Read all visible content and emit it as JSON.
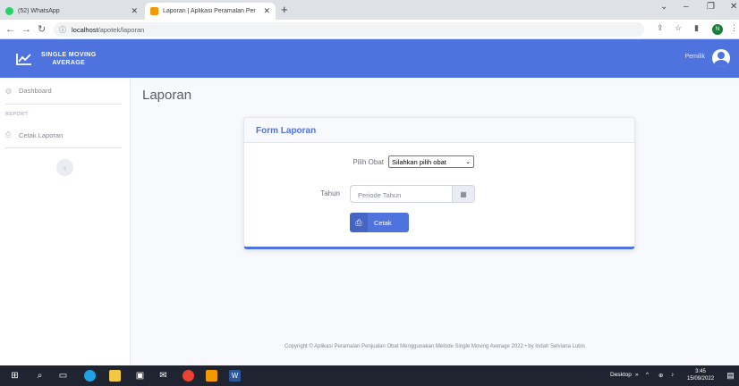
{
  "browser": {
    "tabs": [
      {
        "label": "(52) WhatsApp",
        "icon": "whatsapp-icon",
        "color": "#25d366"
      },
      {
        "label": "Laporan | Aplikasi Peramalan Per",
        "icon": "app-favicon",
        "color": "#f29900"
      }
    ],
    "url_host": "localhost",
    "url_path": "/apotek/laporan",
    "profile_initial": "N"
  },
  "app": {
    "brand_line1": "SINGLE MOVING",
    "brand_line2": "AVERAGE",
    "user_name": "Pemilik",
    "primary_color": "#4e73df"
  },
  "sidebar": {
    "dashboard_label": "Dashboard",
    "heading": "REPORT",
    "cetak_label": "Cetak Laporan",
    "toggle": "‹"
  },
  "main": {
    "page_title": "Laporan",
    "card_title": "Form Laporan",
    "obat_label": "Pilih Obat",
    "obat_selected": "Silahkan pilih obat",
    "tahun_label": "Tahun",
    "tahun_placeholder": "Periode Tahun",
    "button_label": "Cetak"
  },
  "footer": {
    "text": "Copyright © Aplikasi Peramalan Penjualan Obat Menggunakan Metode Single Moving Average 2022 • by Indah Selviana Lubis"
  },
  "taskbar": {
    "desktop_label": "Desktop",
    "time": "3:45",
    "date": "15/09/2022"
  }
}
